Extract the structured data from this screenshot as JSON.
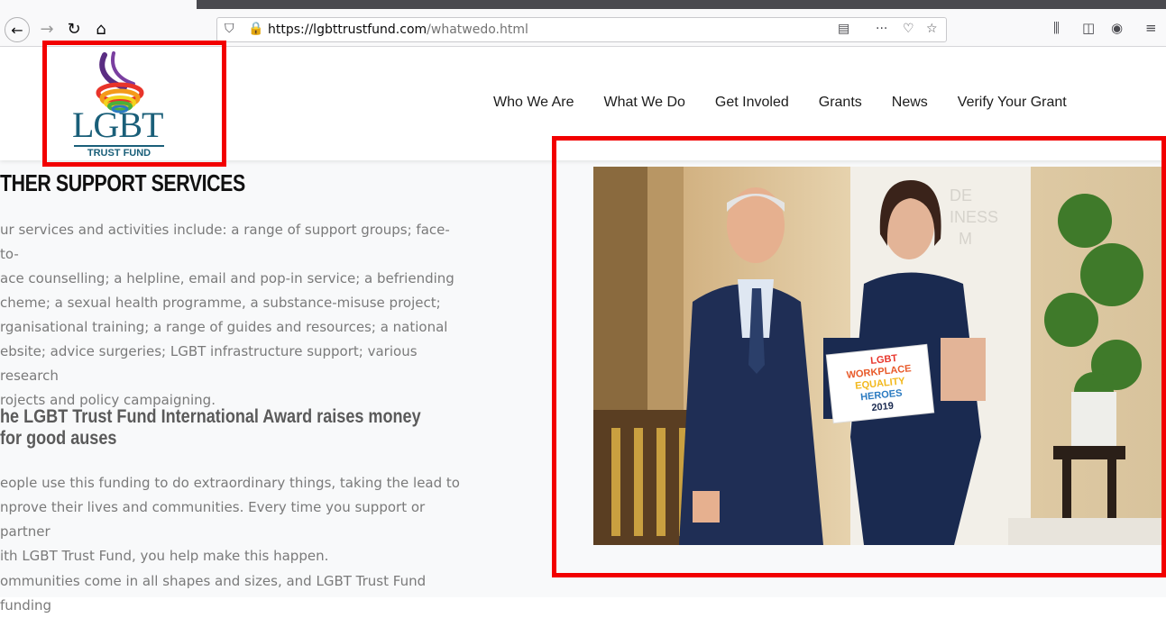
{
  "browser": {
    "url_domain": "https://lgbttrustfund.com",
    "url_path": "/whatwedo.html"
  },
  "logo": {
    "title": "LGBT",
    "subtitle": "TRUST FUND"
  },
  "nav": {
    "items": [
      {
        "label": "Who We Are"
      },
      {
        "label": "What We Do"
      },
      {
        "label": "Get Involed"
      },
      {
        "label": "Grants"
      },
      {
        "label": "News"
      },
      {
        "label": "Verify Your Grant"
      }
    ]
  },
  "content": {
    "heading1": "THER SUPPORT SERVICES",
    "para1_lines": [
      "ur services and activities include: a range of support groups; face-to-",
      "ace counselling; a helpline, email and pop-in service; a befriending",
      "cheme; a sexual health programme, a substance-misuse project;",
      "rganisational training; a range of guides and resources; a national",
      "ebsite; advice surgeries; LGBT infrastructure support; various research",
      "rojects and policy campaigning."
    ],
    "heading2": "he LGBT Trust Fund International Award raises money for good auses",
    "para2_lines": [
      "eople use this funding to do extraordinary things, taking the lead to",
      "nprove their lives and communities. Every time you support or partner",
      "ith LGBT Trust Fund, you help make this happen."
    ],
    "para3": "ommunities come in all shapes and sizes, and LGBT Trust Fund funding"
  },
  "photo": {
    "sign_lines": [
      "LGBT",
      "WORKPLACE",
      "EQUALITY",
      "HEROES",
      "2019"
    ],
    "banner_lines": [
      "DE",
      "INESS",
      "M"
    ]
  },
  "colors": {
    "highlight": "#f20000",
    "logo_blue": "#1a5f79"
  }
}
